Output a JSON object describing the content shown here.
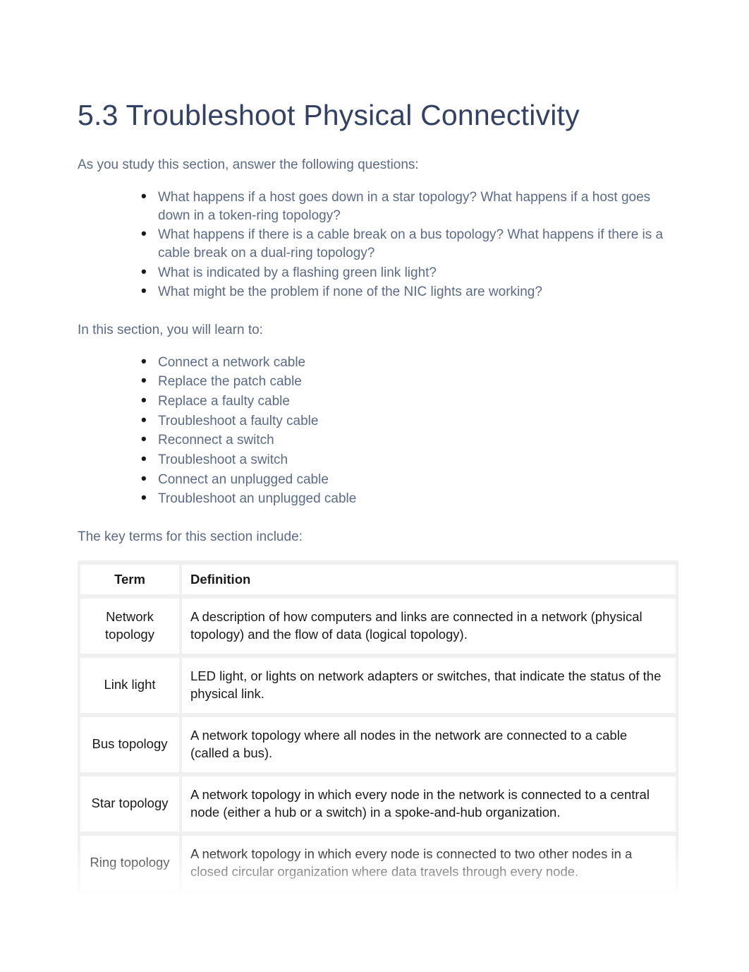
{
  "title": "5.3 Troubleshoot Physical Connectivity",
  "intro1": "As you study this section, answer the following questions:",
  "questions": [
    "What happens if a host goes down in a star topology? What happens if a host goes down in a token-ring topology?",
    "What happens if there is a cable break on a bus topology? What happens if there is a cable break on a dual-ring topology?",
    "What is indicated by a flashing green link light?",
    "What might be the problem if none of the NIC lights are working?"
  ],
  "intro2": "In this section, you will learn to:",
  "learn": [
    "Connect a network cable",
    "Replace the patch cable",
    "Replace a faulty cable",
    "Troubleshoot a faulty cable",
    "Reconnect a switch",
    "Troubleshoot a switch",
    "Connect an unplugged cable",
    "Troubleshoot an unplugged cable"
  ],
  "intro3": "The key terms for this section include:",
  "table": {
    "headers": {
      "term": "Term",
      "definition": "Definition"
    },
    "rows": [
      {
        "term": "Network topology",
        "definition": "A description of how computers and links are connected in a network (physical topology) and the flow of data (logical topology)."
      },
      {
        "term": "Link light",
        "definition": "LED light, or lights on network adapters or switches, that indicate the status of the physical link."
      },
      {
        "term": "Bus topology",
        "definition": "A network topology where all nodes in the network are connected to a cable (called a bus)."
      },
      {
        "term": "Star topology",
        "definition": "A network topology in which every node in the network is connected to a central node (either a hub or a switch) in a spoke-and-hub organization."
      },
      {
        "term": "Ring topology",
        "definition": "A network topology in which every node is connected to two other nodes in a closed circular organization where data travels through every node."
      }
    ]
  }
}
